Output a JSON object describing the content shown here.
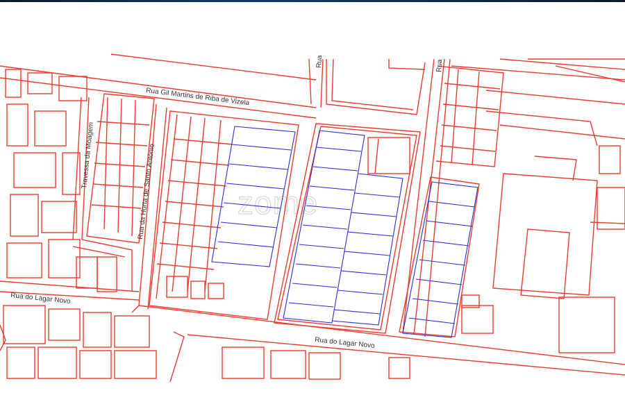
{
  "map": {
    "streets": [
      "Rua Gil Martins de Riba de Vizela",
      "Travessa da Moagem",
      "Rua da Horta de Santo António",
      "Rua do Lagar Novo",
      "Rua do Lagar Novo",
      "Rua"
    ],
    "watermark": "zome",
    "colors": {
      "parcel_outline": "#ec3b2c",
      "lot_division": "#2a2fd6",
      "background": "#ffffff"
    }
  }
}
